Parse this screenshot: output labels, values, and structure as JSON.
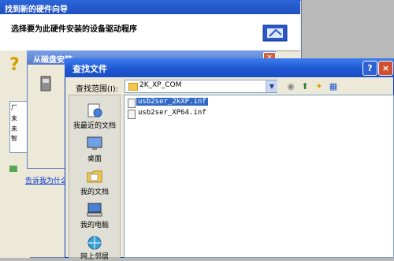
{
  "wizard": {
    "title": "找到新的硬件向导",
    "subtitle": "选择要为此硬件安装的设备驱动程序",
    "list_lines": [
      "厂",
      "未",
      "未",
      "智"
    ],
    "link": "告诉我为什么"
  },
  "disk_dialog": {
    "title": "从磁盘安装",
    "close_label": "×"
  },
  "find_dialog": {
    "title": "查找文件",
    "help_label": "?",
    "close_label": "×",
    "lookin_label": "查找范围(I):",
    "lookin_value": "2K_XP_COM",
    "places": [
      "我最近的文档",
      "桌面",
      "我的文档",
      "我的电脑",
      "网上邻居"
    ],
    "files": [
      {
        "name": "usb2ser_2kXP.inf",
        "selected": true
      },
      {
        "name": "usb2ser_XP64.inf",
        "selected": false
      }
    ]
  },
  "icons": {
    "toolbar": [
      "back-icon",
      "up-folder-icon",
      "new-folder-icon",
      "views-menu-icon"
    ]
  },
  "colors": {
    "titlebar_active": "#1d55cf",
    "titlebar_inactive": "#5879c8",
    "selection": "#316ac5",
    "dialog_bg": "#ece9d8"
  }
}
